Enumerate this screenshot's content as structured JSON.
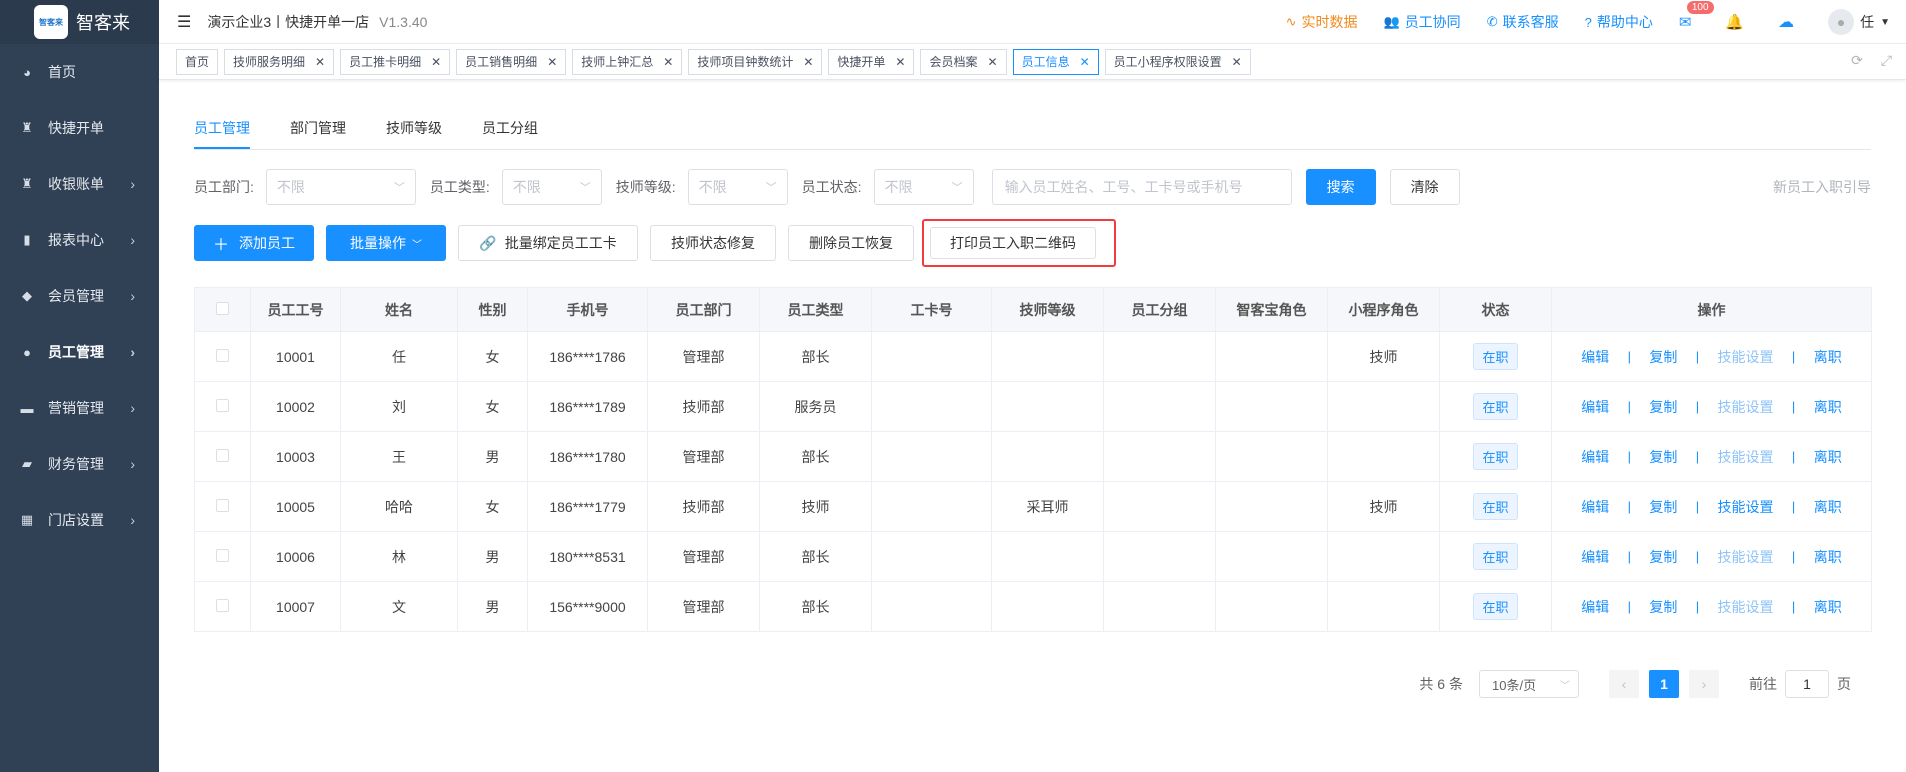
{
  "sidebar": {
    "logo_text": "智客来",
    "logo_badge": "智客来",
    "items": [
      {
        "label": "首页",
        "icon": "dashboard-icon",
        "glyph": "◕",
        "has_arrow": false
      },
      {
        "label": "快捷开单",
        "icon": "bag-icon",
        "glyph": "♜",
        "has_arrow": false
      },
      {
        "label": "收银账单",
        "icon": "bag-icon",
        "glyph": "♜",
        "has_arrow": true
      },
      {
        "label": "报表中心",
        "icon": "bar-chart-icon",
        "glyph": "▮",
        "has_arrow": true
      },
      {
        "label": "会员管理",
        "icon": "diamond-icon",
        "glyph": "◆",
        "has_arrow": true
      },
      {
        "label": "员工管理",
        "icon": "user-icon",
        "glyph": "●",
        "has_arrow": true
      },
      {
        "label": "营销管理",
        "icon": "briefcase-icon",
        "glyph": "▬",
        "has_arrow": true
      },
      {
        "label": "财务管理",
        "icon": "wallet-icon",
        "glyph": "▰",
        "has_arrow": true
      },
      {
        "label": "门店设置",
        "icon": "grid-icon",
        "glyph": "▦",
        "has_arrow": true
      }
    ],
    "active_index": 5
  },
  "header": {
    "store": "演示企业3丨快捷开单一店",
    "version": "V1.3.40",
    "links": [
      {
        "label": "实时数据",
        "icon": "pulse-icon",
        "glyph": "∿",
        "color": "#f18a1c"
      },
      {
        "label": "员工协同",
        "icon": "users-icon",
        "glyph": "👥",
        "color": "#1890ff"
      },
      {
        "label": "联系客服",
        "icon": "phone-icon",
        "glyph": "✆",
        "color": "#1890ff"
      },
      {
        "label": "帮助中心",
        "icon": "help-icon",
        "glyph": "?",
        "color": "#1890ff"
      }
    ],
    "mail_badge": "100",
    "user_name": "任"
  },
  "tags": [
    {
      "label": "首页",
      "closable": false,
      "active": false
    },
    {
      "label": "技师服务明细",
      "closable": true,
      "active": false
    },
    {
      "label": "员工推卡明细",
      "closable": true,
      "active": false
    },
    {
      "label": "员工销售明细",
      "closable": true,
      "active": false
    },
    {
      "label": "技师上钟汇总",
      "closable": true,
      "active": false
    },
    {
      "label": "技师项目钟数统计",
      "closable": true,
      "active": false
    },
    {
      "label": "快捷开单",
      "closable": true,
      "active": false
    },
    {
      "label": "会员档案",
      "closable": true,
      "active": false
    },
    {
      "label": "员工信息",
      "closable": true,
      "active": true
    },
    {
      "label": "员工小程序权限设置",
      "closable": true,
      "active": false
    }
  ],
  "subtabs": [
    "员工管理",
    "部门管理",
    "技师等级",
    "员工分组"
  ],
  "filters": {
    "dept_label": "员工部门:",
    "type_label": "员工类型:",
    "level_label": "技师等级:",
    "status_label": "员工状态:",
    "unlimited": "不限",
    "search_placeholder": "输入员工姓名、工号、工卡号或手机号",
    "search_btn": "搜索",
    "clear_btn": "清除",
    "guide_link": "新员工入职引导"
  },
  "actions": {
    "add": "添加员工",
    "batch": "批量操作",
    "bind_card": "批量绑定员工工卡",
    "fix_status": "技师状态修复",
    "restore": "删除员工恢复",
    "print_qr": "打印员工入职二维码"
  },
  "table": {
    "headers": [
      "员工工号",
      "姓名",
      "性别",
      "手机号",
      "员工部门",
      "员工类型",
      "工卡号",
      "技师等级",
      "员工分组",
      "智客宝角色",
      "小程序角色",
      "状态",
      "操作"
    ],
    "rows": [
      {
        "id": "10001",
        "name": "任",
        "gender": "女",
        "phone": "186****1786",
        "dept": "管理部",
        "type": "部长",
        "card": "",
        "level": "",
        "group": "",
        "zkb_role": "",
        "mp_role": "技师",
        "status": "在职",
        "skill_enabled": false
      },
      {
        "id": "10002",
        "name": "刘",
        "gender": "女",
        "phone": "186****1789",
        "dept": "技师部",
        "type": "服务员",
        "card": "",
        "level": "",
        "group": "",
        "zkb_role": "",
        "mp_role": "",
        "status": "在职",
        "skill_enabled": false
      },
      {
        "id": "10003",
        "name": "王",
        "gender": "男",
        "phone": "186****1780",
        "dept": "管理部",
        "type": "部长",
        "card": "",
        "level": "",
        "group": "",
        "zkb_role": "",
        "mp_role": "",
        "status": "在职",
        "skill_enabled": false
      },
      {
        "id": "10005",
        "name": "哈哈",
        "gender": "女",
        "phone": "186****1779",
        "dept": "技师部",
        "type": "技师",
        "card": "",
        "level": "采耳师",
        "group": "",
        "zkb_role": "",
        "mp_role": "技师",
        "status": "在职",
        "skill_enabled": true
      },
      {
        "id": "10006",
        "name": "林",
        "gender": "男",
        "phone": "180****8531",
        "dept": "管理部",
        "type": "部长",
        "card": "",
        "level": "",
        "group": "",
        "zkb_role": "",
        "mp_role": "",
        "status": "在职",
        "skill_enabled": false
      },
      {
        "id": "10007",
        "name": "文",
        "gender": "男",
        "phone": "156****9000",
        "dept": "管理部",
        "type": "部长",
        "card": "",
        "level": "",
        "group": "",
        "zkb_role": "",
        "mp_role": "",
        "status": "在职",
        "skill_enabled": false
      }
    ],
    "ops": {
      "edit": "编辑",
      "copy": "复制",
      "skill": "技能设置",
      "leave": "离职"
    }
  },
  "pager": {
    "total": "共 6 条",
    "page_size": "10条/页",
    "current": "1",
    "goto_label": "前往",
    "goto_value": "1",
    "page_suffix": "页"
  }
}
